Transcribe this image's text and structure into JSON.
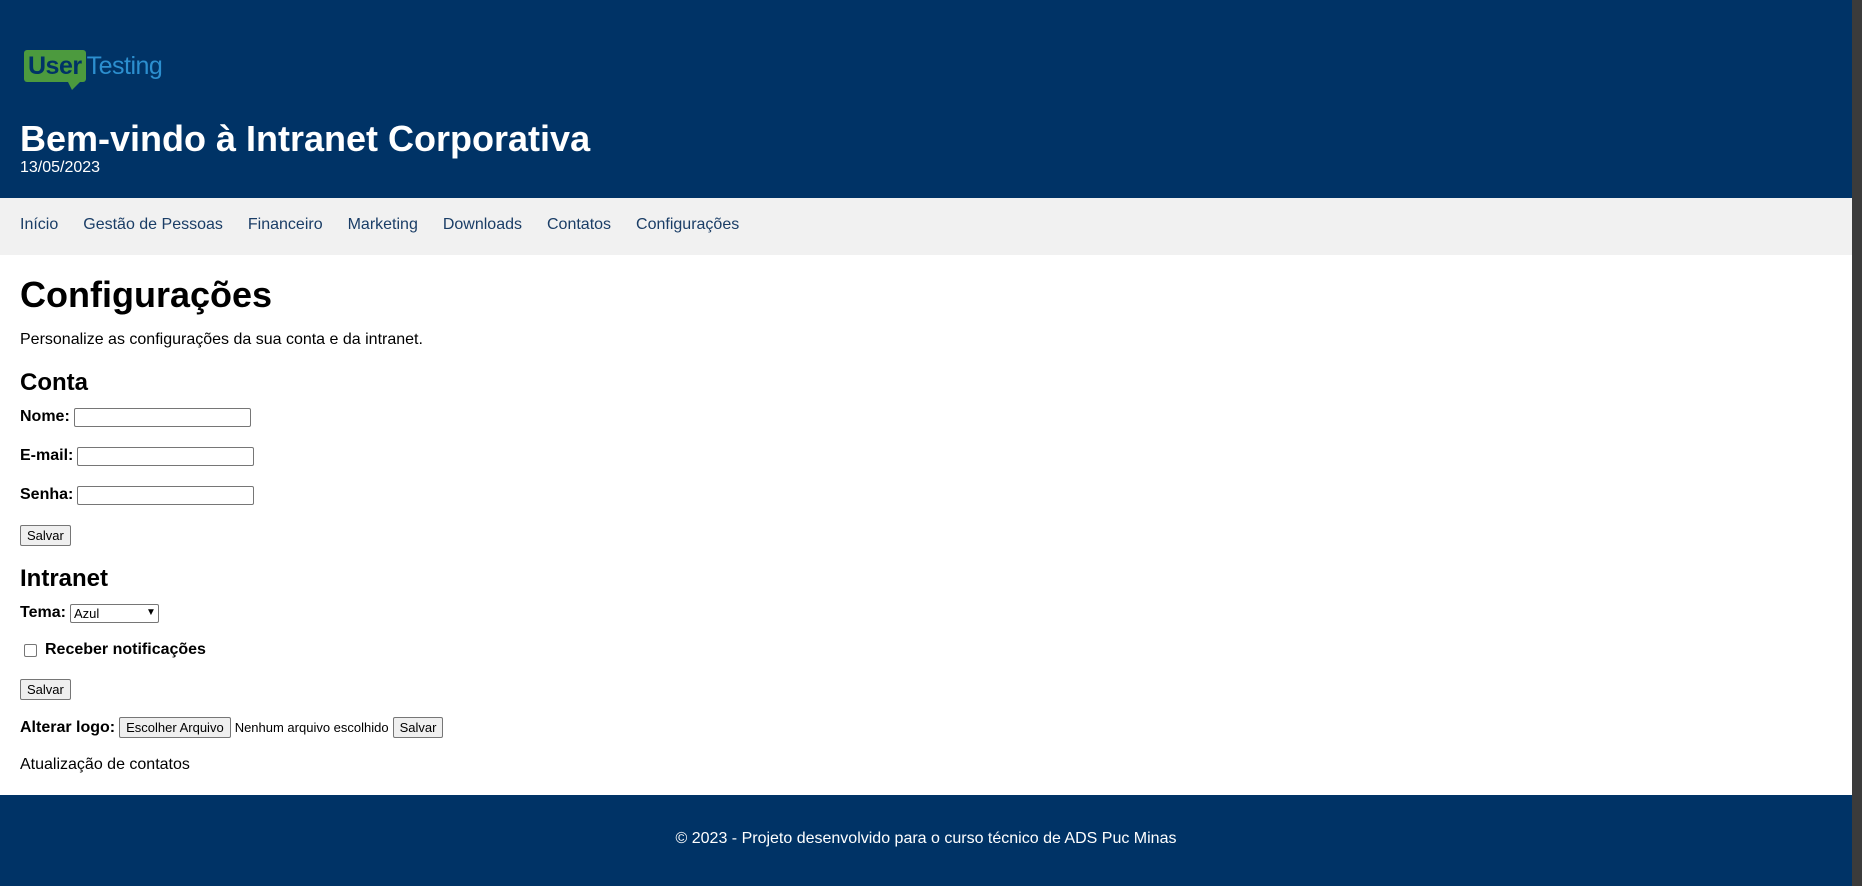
{
  "header": {
    "logo": {
      "part1": "User",
      "part2": "Testing"
    },
    "title": "Bem-vindo à Intranet Corporativa",
    "date": "13/05/2023"
  },
  "nav": {
    "items": [
      {
        "label": "Início"
      },
      {
        "label": "Gestão de Pessoas"
      },
      {
        "label": "Financeiro"
      },
      {
        "label": "Marketing"
      },
      {
        "label": "Downloads"
      },
      {
        "label": "Contatos"
      },
      {
        "label": "Configurações"
      }
    ]
  },
  "main": {
    "heading": "Configurações",
    "description": "Personalize as configurações da sua conta e da intranet.",
    "account": {
      "heading": "Conta",
      "name_label": "Nome:",
      "name_value": "",
      "email_label": "E-mail:",
      "email_value": "",
      "password_label": "Senha:",
      "password_value": "",
      "save_label": "Salvar"
    },
    "intranet": {
      "heading": "Intranet",
      "theme_label": "Tema:",
      "theme_selected": "Azul",
      "notifications_label": "Receber notificações",
      "notifications_checked": false,
      "save_label": "Salvar"
    },
    "logo_change": {
      "label": "Alterar logo:",
      "choose_file_label": "Escolher Arquivo",
      "file_status": "Nenhum arquivo escolhido",
      "save_label": "Salvar"
    },
    "contacts_update": "Atualização de contatos"
  },
  "footer": {
    "text": "© 2023 - Projeto desenvolvido para o curso técnico de ADS Puc Minas"
  },
  "colors": {
    "header_bg": "#003366",
    "nav_bg": "#f1f1f1",
    "nav_link": "#1a3d66",
    "logo_green": "#4c9a3e",
    "logo_blue": "#2c8fcf"
  },
  "icons": {
    "select_arrow": "chevron-down-icon"
  }
}
